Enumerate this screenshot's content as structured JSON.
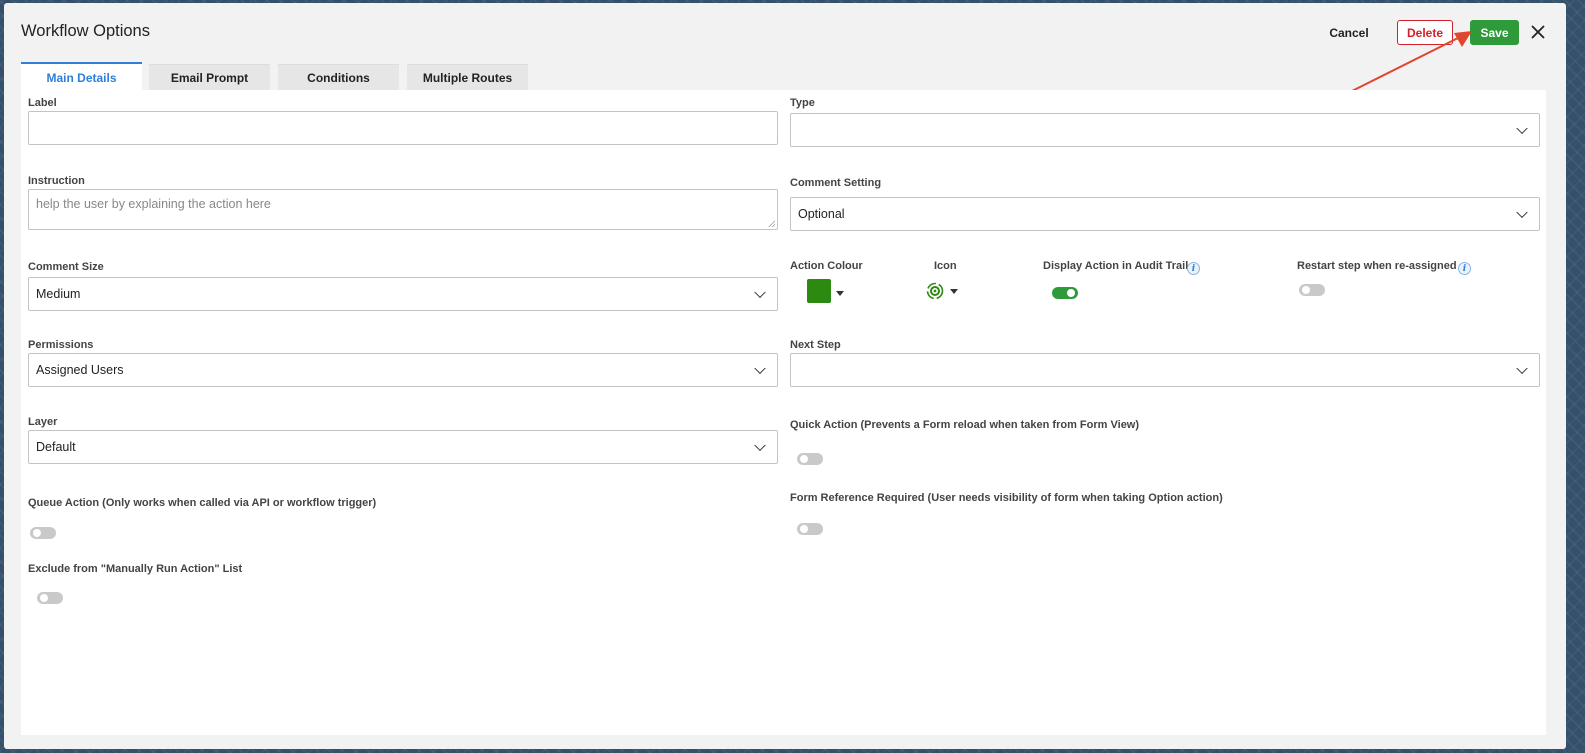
{
  "dialog": {
    "title": "Workflow Options",
    "cancel_label": "Cancel",
    "delete_label": "Delete",
    "save_label": "Save",
    "close_icon": "close-icon"
  },
  "tabs": [
    {
      "label": "Main Details",
      "active": true
    },
    {
      "label": "Email Prompt",
      "active": false
    },
    {
      "label": "Conditions",
      "active": false
    },
    {
      "label": "Multiple Routes",
      "active": false
    }
  ],
  "fields": {
    "label": {
      "label": "Label",
      "value": ""
    },
    "type": {
      "label": "Type",
      "value": ""
    },
    "instruction": {
      "label": "Instruction",
      "placeholder": "help the user by explaining the action here"
    },
    "comment_setting": {
      "label": "Comment Setting",
      "value": "Optional"
    },
    "comment_size": {
      "label": "Comment Size",
      "value": "Medium"
    },
    "action_colour": {
      "label": "Action Colour",
      "color": "#2c8a12"
    },
    "icon": {
      "label": "Icon",
      "icon": "gear-refresh-icon",
      "color": "#2c8a12"
    },
    "display_audit": {
      "label": "Display Action in Audit Trail",
      "on": true
    },
    "restart_step": {
      "label": "Restart step when re-assigned",
      "on": false
    },
    "permissions": {
      "label": "Permissions",
      "value": "Assigned Users"
    },
    "next_step": {
      "label": "Next Step",
      "value": ""
    },
    "layer": {
      "label": "Layer",
      "value": "Default"
    },
    "quick_action": {
      "label": "Quick Action (Prevents a Form reload when taken from Form View)",
      "on": false
    },
    "queue_action": {
      "label": "Queue Action (Only works when called via API or workflow trigger)",
      "on": false
    },
    "form_reference": {
      "label": "Form Reference Required (User needs visibility of form when taking Option action)",
      "on": false
    },
    "exclude_manual": {
      "label": "Exclude from \"Manually Run Action\" List",
      "on": false
    }
  },
  "colors": {
    "accent": "#2f7fd8",
    "save": "#2e9a3a",
    "delete": "#d4202a",
    "annotation_arrow": "#e0452f"
  }
}
